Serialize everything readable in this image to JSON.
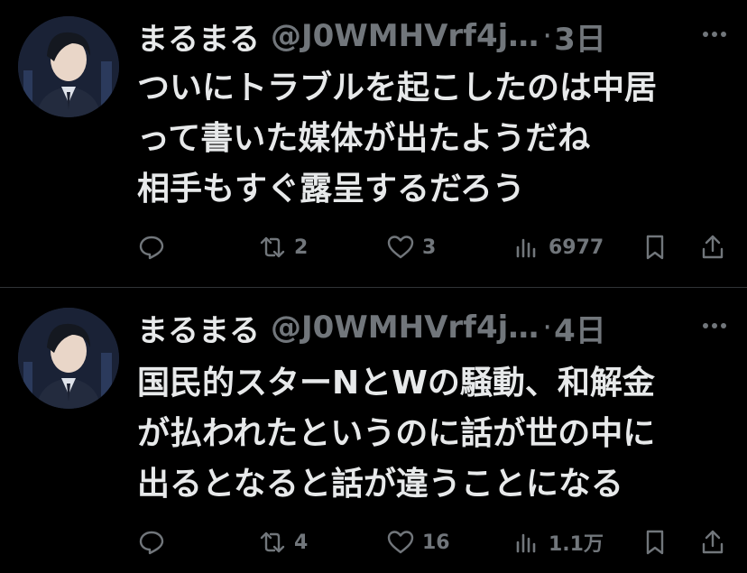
{
  "tweets": [
    {
      "name": "まるまる",
      "handle": "@J0WMHVrf4j…",
      "separator": "·",
      "time": "3日",
      "lines": [
        "ついにトラブルを起こしたのは中居",
        "って書いた媒体が出たようだね",
        "相手もすぐ露呈するだろう"
      ],
      "retweets": "2",
      "likes": "3",
      "views": "6977"
    },
    {
      "name": "まるまる",
      "handle": "@J0WMHVrf4j…",
      "separator": "·",
      "time": "4日",
      "lines": [
        "国民的スターNとWの騒動、和解金",
        "が払われたというのに話が世の中に",
        "出るとなると話が違うことになる"
      ],
      "retweets": "4",
      "likes": "16",
      "views": "1.1万"
    }
  ],
  "colors": {
    "background": "#000000",
    "text": "#e7e9ea",
    "muted": "#71767b",
    "divider": "#2f3336"
  },
  "icons": [
    "avatar",
    "more-icon",
    "reply-icon",
    "retweet-icon",
    "like-icon",
    "views-icon",
    "bookmark-icon",
    "share-icon"
  ]
}
